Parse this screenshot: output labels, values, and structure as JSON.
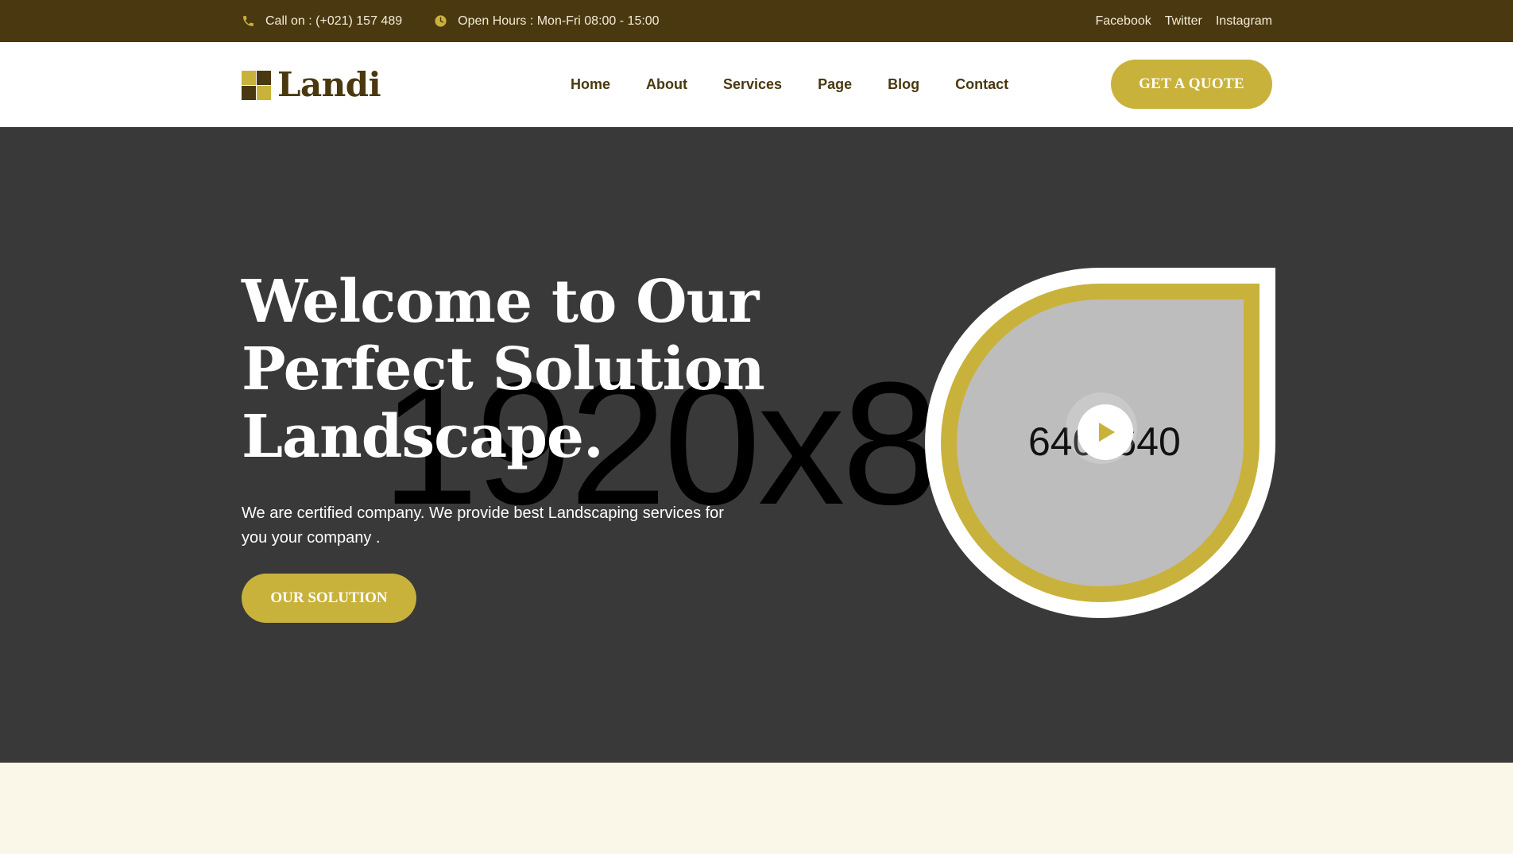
{
  "topbar": {
    "phone": "Call on : (+021) 157 489",
    "hours": "Open Hours : Mon-Fri 08:00 - 15:00",
    "social": [
      "Facebook",
      "Twitter",
      "Instagram"
    ]
  },
  "header": {
    "logo_text": "Landi",
    "nav": [
      "Home",
      "About",
      "Services",
      "Page",
      "Blog",
      "Contact"
    ],
    "cta_label": "GET A QUOTE"
  },
  "hero": {
    "title_lines": [
      "Welcome to Our",
      "Perfect Solution",
      "Landscape."
    ],
    "description": "We are certified company. We provide best Landscaping services for you your company .",
    "button_label": "OUR SOLUTION",
    "bg_placeholder": "1920x8",
    "video_placeholder": "640x640"
  },
  "colors": {
    "topbar_bg": "#4a3810",
    "accent": "#c9b23c",
    "hero_bg": "#393939",
    "text_dark": "#4a3810"
  },
  "icons": {
    "phone": "phone-icon",
    "clock": "clock-icon",
    "play": "play-icon"
  }
}
